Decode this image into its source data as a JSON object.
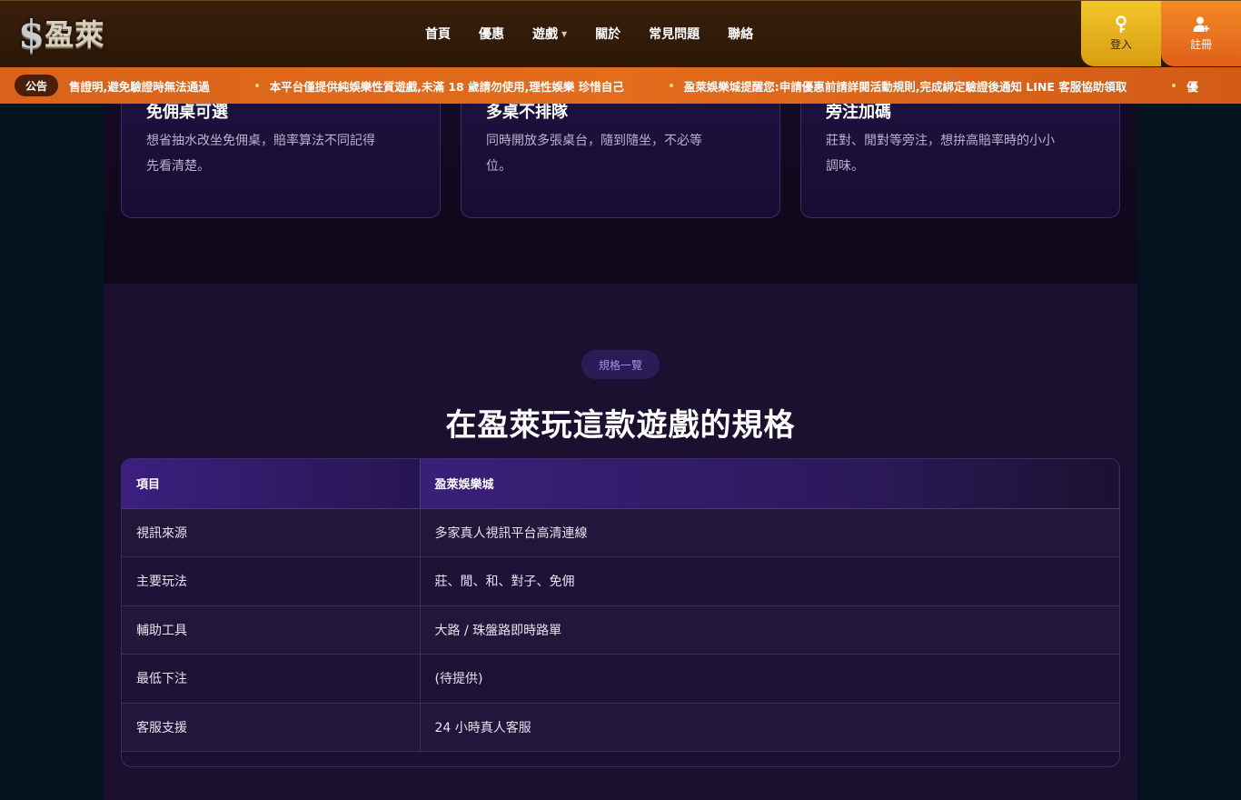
{
  "header": {
    "logo_symbol": "$",
    "logo_text": "盈萊",
    "nav": [
      "首頁",
      "優惠",
      "遊戲",
      "關於",
      "常見問題",
      "聯絡"
    ],
    "login_label": "登入",
    "register_label": "註冊"
  },
  "marquee": {
    "badge": "公告",
    "messages": [
      "售證明,避免驗證時無法通過",
      "本平台僅提供純娛樂性質遊戲,未滿 18 歲請勿使用,理性娛樂 珍惜自己",
      "盈萊娛樂城提醒您:申請優惠前請詳閱活動規則,完成綁定驗證後通知 LINE 客服協助領取",
      "優"
    ]
  },
  "features": [
    {
      "title": "免佣桌可選",
      "desc_line1": "想省抽水改坐免佣桌，賠率算法不同記得",
      "desc_line2": "先看清楚。"
    },
    {
      "title": "多桌不排隊",
      "desc_line1": "同時開放多張桌台，隨到隨坐，不必等",
      "desc_line2": "位。"
    },
    {
      "title": "旁注加碼",
      "desc_line1": "莊對、閒對等旁注，想拚高賠率時的小小",
      "desc_line2": "調味。"
    }
  ],
  "spec": {
    "pill": "規格一覽",
    "title": "在盈萊玩這款遊戲的規格",
    "table": {
      "headers": [
        "項目",
        "盈萊娛樂城"
      ],
      "rows": [
        [
          "視訊來源",
          "多家真人視訊平台高清連線"
        ],
        [
          "主要玩法",
          "莊、閒、和、對子、免佣"
        ],
        [
          "輔助工具",
          "大路 / 珠盤路即時路單"
        ],
        [
          "最低下注",
          "(待提供)"
        ],
        [
          "客服支援",
          "24 小時真人客服"
        ]
      ]
    }
  },
  "colors": {
    "accent_gold": "#f2c62a",
    "accent_orange": "#e0601a",
    "accent_purple": "#a88cf2"
  }
}
